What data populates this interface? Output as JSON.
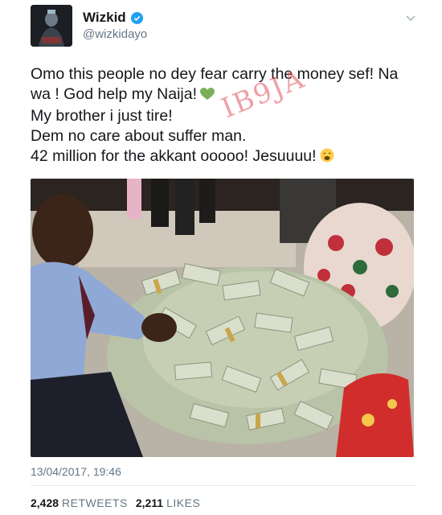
{
  "author": {
    "name": "Wizkid",
    "handle": "@wizkidayo",
    "verified": true,
    "avatar_icon": "profile-photo-avatar"
  },
  "tweet": {
    "lines": [
      "Omo this people no dey fear carry the money sef! Na",
      "wa ! God help my Naija!",
      "My brother i just tire!",
      "Dem no care about suffer man.",
      "42 million for the akkant ooooo!  Jesuuuu!"
    ],
    "emojis": [
      "green-heart-icon",
      "weary-face-icon"
    ]
  },
  "watermark": "IB9JA",
  "media": {
    "description_icon": "photo-money-pile"
  },
  "meta": {
    "timestamp": "13/04/2017, 19:46",
    "retweets_count": "2,428",
    "retweets_label": "RETWEETS",
    "likes_count": "2,211",
    "likes_label": "LIKES"
  },
  "colors": {
    "verified": "#1da1f2",
    "muted": "#657786",
    "text": "#14171a"
  }
}
